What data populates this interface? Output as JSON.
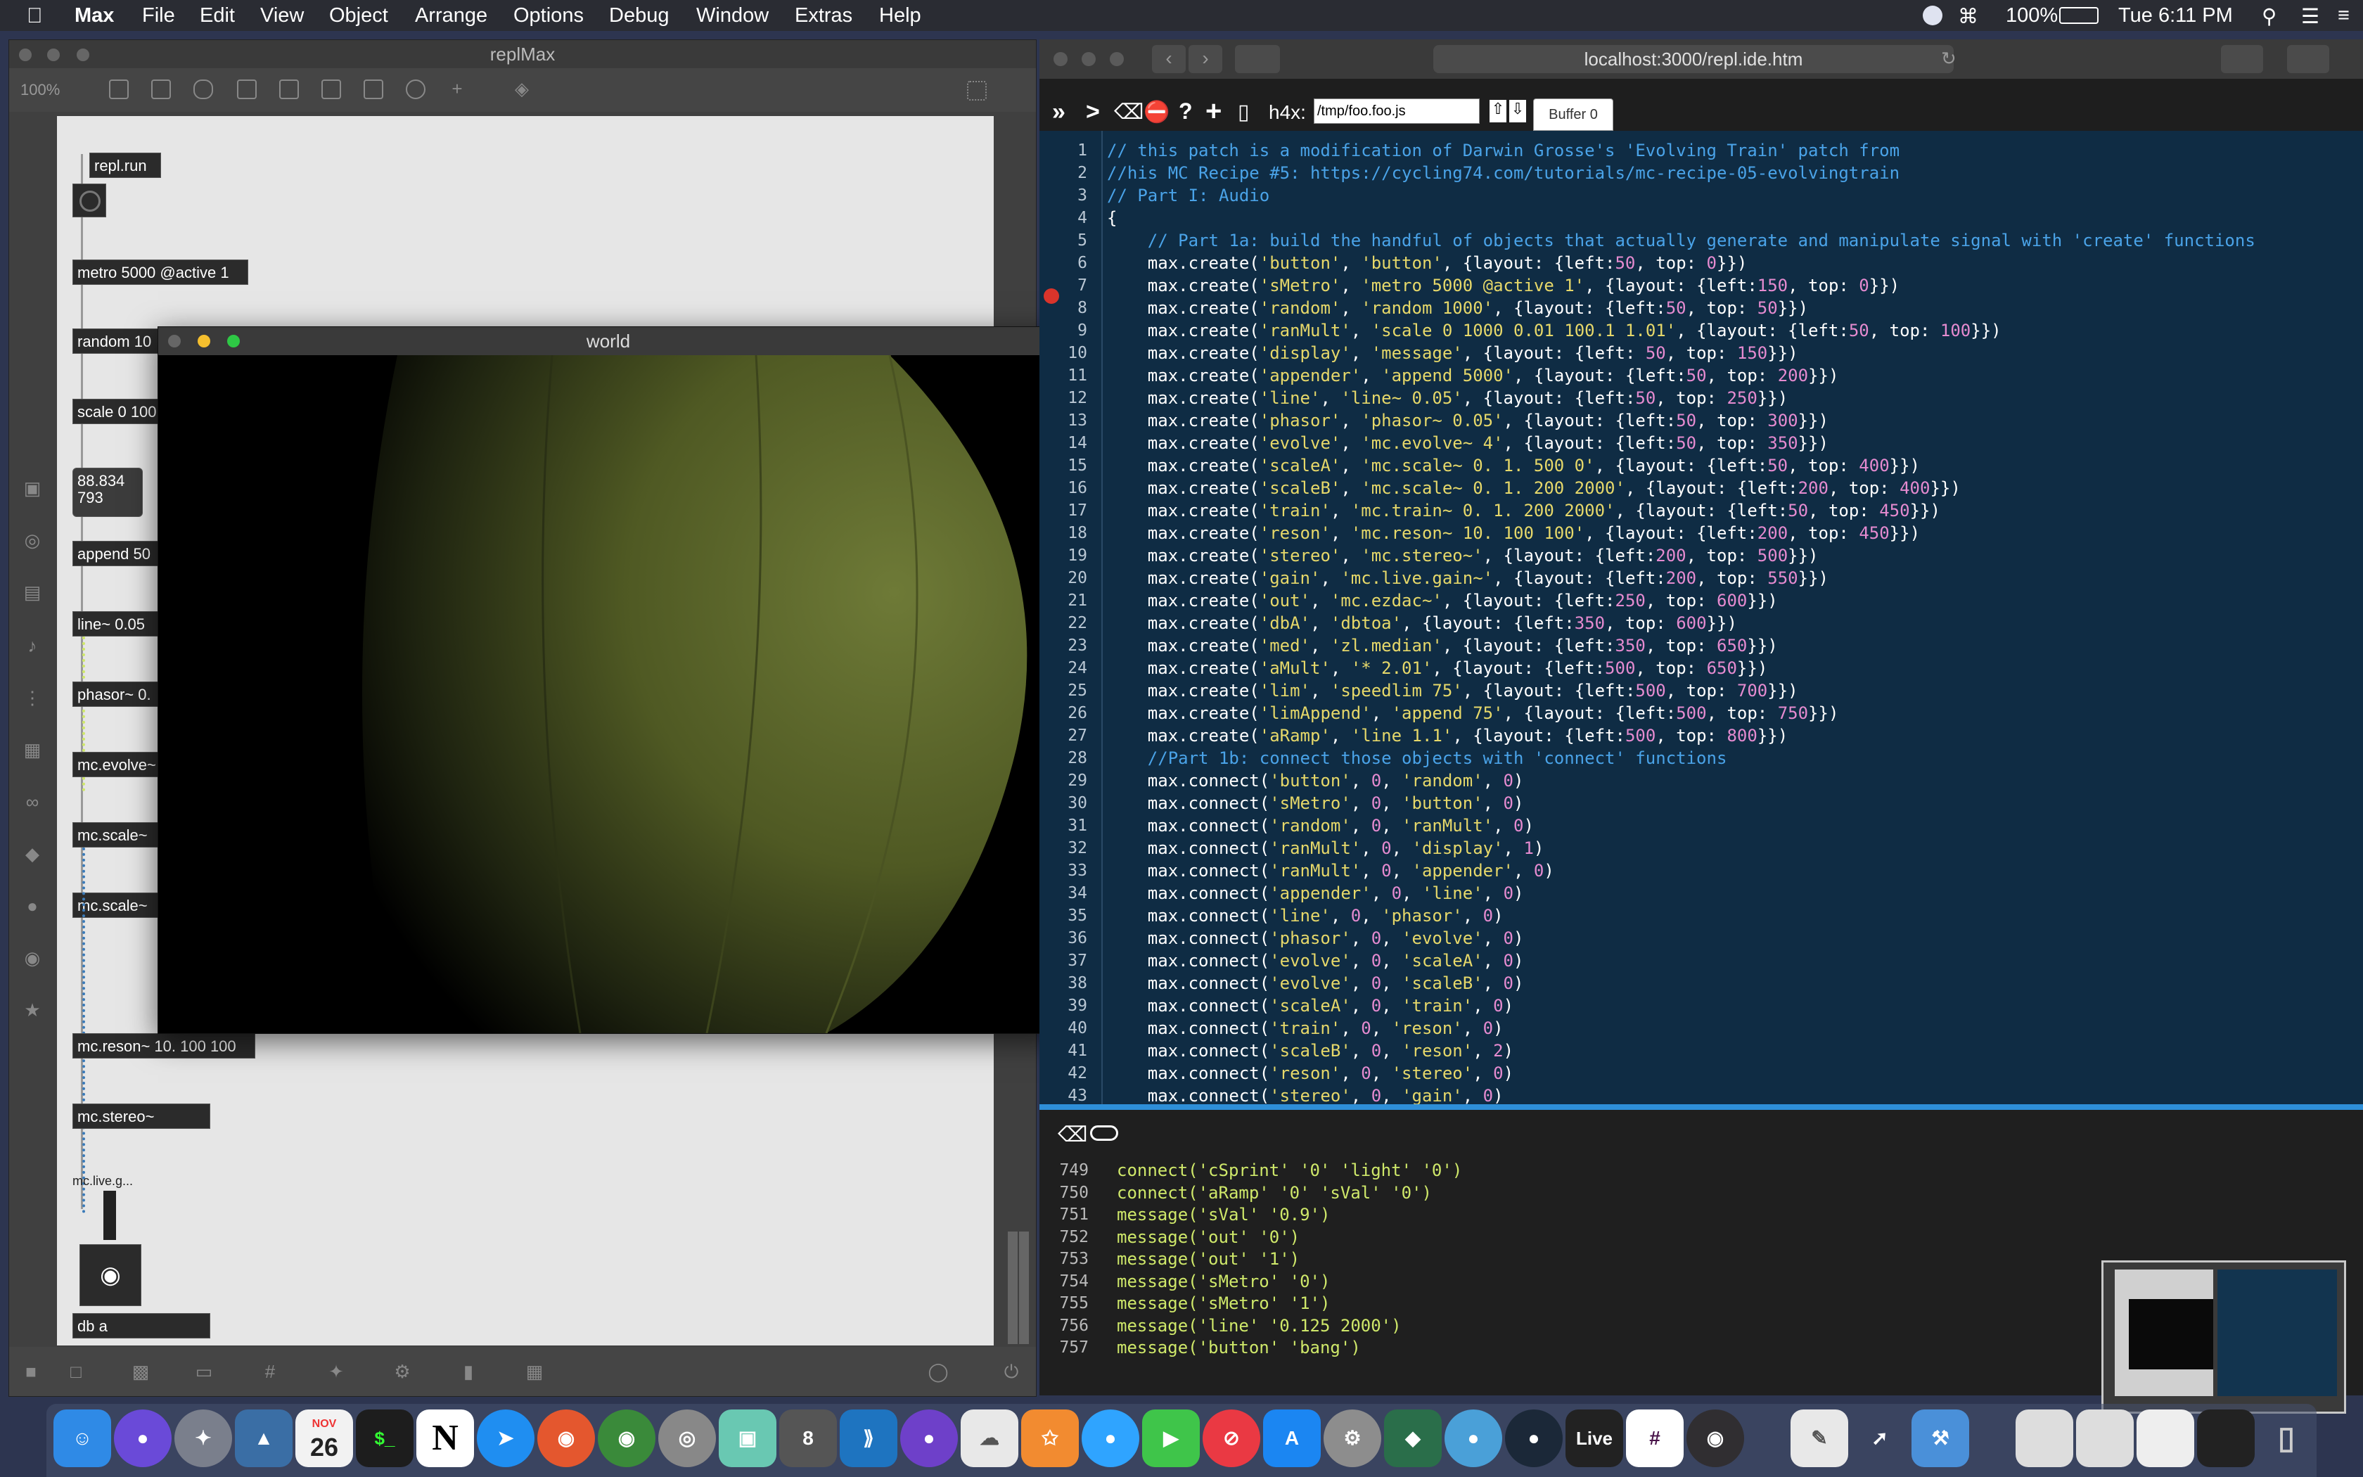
{
  "menubar": {
    "apple": "",
    "app": "Max",
    "items": [
      "File",
      "Edit",
      "View",
      "Object",
      "Arrange",
      "Options",
      "Debug",
      "Window",
      "Extras",
      "Help"
    ],
    "battery": "100%",
    "clock": "Tue 6:11 PM"
  },
  "max_window": {
    "title": "replMax",
    "zoom": "100%",
    "objects": {
      "repl_run": "repl.run",
      "metro": "metro 5000 @active 1",
      "random": "random 10",
      "scale": "scale 0 100",
      "display": "88.834\n793",
      "append": "append 50",
      "line": "line~ 0.05",
      "phasor": "phasor~ 0.",
      "evolve": "mc.evolve~",
      "scale_a": "mc.scale~",
      "scale_b": "mc.scale~",
      "reson": "mc.reson~ 10. 100 100",
      "stereo": "mc.stereo~",
      "live_gain": "mc.live.g...",
      "dbtoa": "db  a"
    }
  },
  "world_window": {
    "title": "world",
    "colors": {
      "sphere": "#545f27",
      "background": "#000000"
    }
  },
  "browser": {
    "url": "localhost:3000/repl.ide.htm",
    "toolbar": {
      "fwd": "»",
      "next": ">",
      "label": "h4x:",
      "path_value": "/tmp/foo.foo.js",
      "buffer_tab": "Buffer 0"
    },
    "code": [
      {
        "n": "1",
        "t": "// this patch is a modification of Darwin Grosse's 'Evolving Train' patch from",
        "c": "comment"
      },
      {
        "n": "2",
        "t": "//his MC Recipe #5: https://cycling74.com/tutorials/mc-recipe-05-evolvingtrain",
        "c": "comment"
      },
      {
        "n": "3",
        "t": "// Part I: Audio",
        "c": "comment"
      },
      {
        "n": "4",
        "t": "{",
        "c": "plain"
      },
      {
        "n": "5",
        "t": "    // Part 1a: build the handful of objects that actually generate and manipulate signal with 'create' functions",
        "c": "comment"
      },
      {
        "n": "6",
        "t": "    max.create('button', 'button', {layout: {left:50, top: 0}})",
        "c": "code"
      },
      {
        "n": "7",
        "t": "    max.create('sMetro', 'metro 5000 @active 1', {layout: {left:150, top: 0}})",
        "c": "code"
      },
      {
        "n": "8",
        "t": "    max.create('random', 'random 1000', {layout: {left:50, top: 50}})",
        "c": "code"
      },
      {
        "n": "9",
        "t": "    max.create('ranMult', 'scale 0 1000 0.01 100.1 1.01', {layout: {left:50, top: 100}})",
        "c": "code"
      },
      {
        "n": "10",
        "t": "    max.create('display', 'message', {layout: {left: 50, top: 150}})",
        "c": "code"
      },
      {
        "n": "11",
        "t": "    max.create('appender', 'append 5000', {layout: {left:50, top: 200}})",
        "c": "code"
      },
      {
        "n": "12",
        "t": "    max.create('line', 'line~ 0.05', {layout: {left:50, top: 250}})",
        "c": "code"
      },
      {
        "n": "13",
        "t": "    max.create('phasor', 'phasor~ 0.05', {layout: {left:50, top: 300}})",
        "c": "code"
      },
      {
        "n": "14",
        "t": "    max.create('evolve', 'mc.evolve~ 4', {layout: {left:50, top: 350}})",
        "c": "code"
      },
      {
        "n": "15",
        "t": "    max.create('scaleA', 'mc.scale~ 0. 1. 500 0', {layout: {left:50, top: 400}})",
        "c": "code"
      },
      {
        "n": "16",
        "t": "    max.create('scaleB', 'mc.scale~ 0. 1. 200 2000', {layout: {left:200, top: 400}})",
        "c": "code"
      },
      {
        "n": "17",
        "t": "    max.create('train', 'mc.train~ 0. 1. 200 2000', {layout: {left:50, top: 450}})",
        "c": "code"
      },
      {
        "n": "18",
        "t": "    max.create('reson', 'mc.reson~ 10. 100 100', {layout: {left:200, top: 450}})",
        "c": "code"
      },
      {
        "n": "19",
        "t": "    max.create('stereo', 'mc.stereo~', {layout: {left:200, top: 500}})",
        "c": "code"
      },
      {
        "n": "20",
        "t": "    max.create('gain', 'mc.live.gain~', {layout: {left:200, top: 550}})",
        "c": "code"
      },
      {
        "n": "21",
        "t": "    max.create('out', 'mc.ezdac~', {layout: {left:250, top: 600}})",
        "c": "code"
      },
      {
        "n": "22",
        "t": "    max.create('dbA', 'dbtoa', {layout: {left:350, top: 600}})",
        "c": "code"
      },
      {
        "n": "23",
        "t": "    max.create('med', 'zl.median', {layout: {left:350, top: 650}})",
        "c": "code"
      },
      {
        "n": "24",
        "t": "    max.create('aMult', '* 2.01', {layout: {left:500, top: 650}})",
        "c": "code"
      },
      {
        "n": "25",
        "t": "    max.create('lim', 'speedlim 75', {layout: {left:500, top: 700}})",
        "c": "code"
      },
      {
        "n": "26",
        "t": "    max.create('limAppend', 'append 75', {layout: {left:500, top: 750}})",
        "c": "code"
      },
      {
        "n": "27",
        "t": "    max.create('aRamp', 'line 1.1', {layout: {left:500, top: 800}})",
        "c": "code"
      },
      {
        "n": "28",
        "t": "    //Part 1b: connect those objects with 'connect' functions",
        "c": "comment"
      },
      {
        "n": "29",
        "t": "    max.connect('button', 0, 'random', 0)",
        "c": "code"
      },
      {
        "n": "30",
        "t": "    max.connect('sMetro', 0, 'button', 0)",
        "c": "code"
      },
      {
        "n": "31",
        "t": "    max.connect('random', 0, 'ranMult', 0)",
        "c": "code"
      },
      {
        "n": "32",
        "t": "    max.connect('ranMult', 0, 'display', 1)",
        "c": "code"
      },
      {
        "n": "33",
        "t": "    max.connect('ranMult', 0, 'appender', 0)",
        "c": "code"
      },
      {
        "n": "34",
        "t": "    max.connect('appender', 0, 'line', 0)",
        "c": "code"
      },
      {
        "n": "35",
        "t": "    max.connect('line', 0, 'phasor', 0)",
        "c": "code"
      },
      {
        "n": "36",
        "t": "    max.connect('phasor', 0, 'evolve', 0)",
        "c": "code"
      },
      {
        "n": "37",
        "t": "    max.connect('evolve', 0, 'scaleA', 0)",
        "c": "code"
      },
      {
        "n": "38",
        "t": "    max.connect('evolve', 0, 'scaleB', 0)",
        "c": "code"
      },
      {
        "n": "39",
        "t": "    max.connect('scaleA', 0, 'train', 0)",
        "c": "code"
      },
      {
        "n": "40",
        "t": "    max.connect('train', 0, 'reson', 0)",
        "c": "code"
      },
      {
        "n": "41",
        "t": "    max.connect('scaleB', 0, 'reson', 2)",
        "c": "code"
      },
      {
        "n": "42",
        "t": "    max.connect('reson', 0, 'stereo', 0)",
        "c": "code"
      },
      {
        "n": "43",
        "t": "    max.connect('stereo', 0, 'gain', 0)",
        "c": "code"
      }
    ],
    "console": [
      {
        "n": "749",
        "t": "connect('cSprint' '0' 'light' '0')"
      },
      {
        "n": "750",
        "t": "connect('aRamp' '0' 'sVal' '0')"
      },
      {
        "n": "751",
        "t": "message('sVal' '0.9')"
      },
      {
        "n": "752",
        "t": "message('out' '0')"
      },
      {
        "n": "753",
        "t": "message('out' '1')"
      },
      {
        "n": "754",
        "t": "message('sMetro' '0')"
      },
      {
        "n": "755",
        "t": "message('sMetro' '1')"
      },
      {
        "n": "756",
        "t": "message('line' '0.125 2000')"
      },
      {
        "n": "757",
        "t": "message('button' 'bang')"
      }
    ],
    "colors": {
      "editor_bg": "#0f2c44",
      "comment": "#4aa3e8",
      "string": "#e6d86a",
      "number": "#e58bd0",
      "console_text": "#cfe86a",
      "split": "#2e8fd8"
    }
  },
  "dock": {
    "calendar_month": "NOV",
    "calendar_day": "26",
    "terminal": "$_",
    "notion": "N",
    "live": "Live"
  }
}
